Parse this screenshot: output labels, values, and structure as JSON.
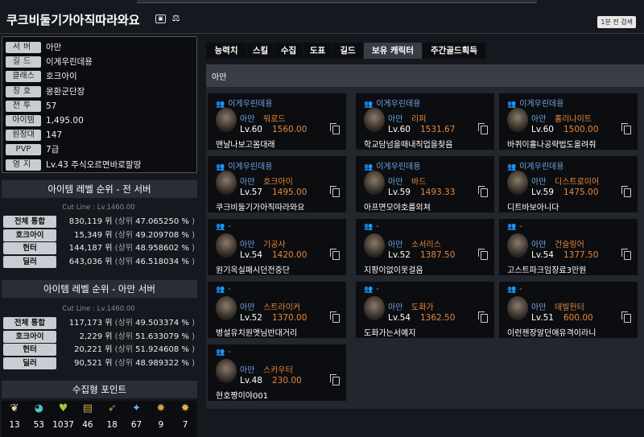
{
  "header": {
    "title": "쿠크비둘기가아직따라와요",
    "badge1": "1분 전 검색"
  },
  "profile": [
    {
      "label": "서버",
      "value": "아만"
    },
    {
      "label": "길드",
      "value": "이게우린데용"
    },
    {
      "label": "클래스",
      "value": "호크아이"
    },
    {
      "label": "칭호",
      "value": "몽환군단장"
    },
    {
      "label": "전투",
      "value": "57"
    },
    {
      "label": "아이템",
      "value": "1,495.00"
    },
    {
      "label": "원정대",
      "value": "147"
    },
    {
      "label": "PVP",
      "value": "7급"
    },
    {
      "label": "영지",
      "value": "Lv.43 주식오르면바로팔땅"
    }
  ],
  "rank_all": {
    "title": "아이템 레벨 순위 - 전 서버",
    "cutline": "Cut Line : Lv.1460.00",
    "rows": [
      {
        "label": "전체 통합",
        "rank": "830,119 위",
        "pct": "47.065250 %"
      },
      {
        "label": "호크아이",
        "rank": "15,349 위",
        "pct": "49.209708 %"
      },
      {
        "label": "헌터",
        "rank": "144,187 위",
        "pct": "48.958602 %"
      },
      {
        "label": "딜러",
        "rank": "643,036 위",
        "pct": "46.518034 %"
      }
    ]
  },
  "rank_server": {
    "title": "아이템 레벨 순위 - 아만 서버",
    "cutline": "Cut Line : Lv.1460.00",
    "rows": [
      {
        "label": "전체 통합",
        "rank": "117,173 위",
        "pct": "49.503374 %"
      },
      {
        "label": "호크아이",
        "rank": "2,229 위",
        "pct": "51.633079 %"
      },
      {
        "label": "헌터",
        "rank": "20,221 위",
        "pct": "51.924608 %"
      },
      {
        "label": "딜러",
        "rank": "90,521 위",
        "pct": "48.989322 %"
      }
    ]
  },
  "rank_common": {
    "open": "(상위",
    "close": ")"
  },
  "collection": {
    "title": "수집형 포인트",
    "items": [
      {
        "icon": "mokoko-icon",
        "glyph": "❦",
        "color": "#e8d8b0",
        "value": "13"
      },
      {
        "icon": "island-icon",
        "glyph": "◕",
        "color": "#4fc3c8",
        "value": "53"
      },
      {
        "icon": "giant-heart-icon",
        "glyph": "♥",
        "color": "#9ac83a",
        "value": "1037"
      },
      {
        "icon": "art-icon",
        "glyph": "▤",
        "color": "#c8a050",
        "value": "46"
      },
      {
        "icon": "voyage-icon",
        "glyph": "➶",
        "color": "#d89a40",
        "value": "18"
      },
      {
        "icon": "ignea-icon",
        "glyph": "✦",
        "color": "#6fb0e8",
        "value": "67"
      },
      {
        "icon": "orpheus-icon",
        "glyph": "✹",
        "color": "#d8a040",
        "value": "9"
      },
      {
        "icon": "world-tree-icon",
        "glyph": "✸",
        "color": "#e8b050",
        "value": "7"
      }
    ]
  },
  "tabs": [
    "능력치",
    "스킬",
    "수집",
    "도표",
    "길드",
    "보유 캐릭터",
    "주간골드획득"
  ],
  "active_tab": "보유 캐릭터",
  "server_label": "아만",
  "characters": [
    {
      "guild": "이게우린데용",
      "server": "아만",
      "cls": "워로드",
      "lv": "Lv.60",
      "ilv": "1560.00",
      "name": "맨날나보고몸대래"
    },
    {
      "guild": "이게우린데용",
      "server": "아만",
      "cls": "리퍼",
      "lv": "Lv.60",
      "ilv": "1531.67",
      "name": "학교담넘을때내직업을찾음"
    },
    {
      "guild": "이게우린데용",
      "server": "아만",
      "cls": "홀리나이트",
      "lv": "Lv.60",
      "ilv": "1500.00",
      "name": "바퀴이홀나공략법도올려줘"
    },
    {
      "guild": "이게우린데용",
      "server": "아만",
      "cls": "호크아이",
      "lv": "Lv.57",
      "ilv": "1495.00",
      "name": "쿠크비둘기가아직따라와요"
    },
    {
      "guild": "이게우린데용",
      "server": "아만",
      "cls": "바드",
      "lv": "Lv.59",
      "ilv": "1493.33",
      "name": "아프면모야호를외쳐"
    },
    {
      "guild": "이게우린데용",
      "server": "아만",
      "cls": "디스트로이어",
      "lv": "Lv.59",
      "ilv": "1475.00",
      "name": "디트바보아니다"
    },
    {
      "guild": "-",
      "server": "아만",
      "cls": "기공사",
      "lv": "Lv.54",
      "ilv": "1420.00",
      "name": "원기옥실패시던전중단"
    },
    {
      "guild": "-",
      "server": "아만",
      "cls": "소서리스",
      "lv": "Lv.52",
      "ilv": "1387.50",
      "name": "지팡이없이못걸음"
    },
    {
      "guild": "-",
      "server": "아만",
      "cls": "건슬링어",
      "lv": "Lv.54",
      "ilv": "1377.50",
      "name": "고스트파크임장료3만원"
    },
    {
      "guild": "-",
      "server": "아만",
      "cls": "스트라이커",
      "lv": "Lv.52",
      "ilv": "1370.00",
      "name": "병설유치원옛님반대거리"
    },
    {
      "guild": "-",
      "server": "아만",
      "cls": "도화가",
      "lv": "Lv.54",
      "ilv": "1362.50",
      "name": "도화가는서예지"
    },
    {
      "guild": "-",
      "server": "아만",
      "cls": "데빌헌터",
      "lv": "Lv.51",
      "ilv": "600.00",
      "name": "이런젠장알던애유격이라니"
    },
    {
      "guild": "-",
      "server": "아만",
      "cls": "스카우터",
      "lv": "Lv.48",
      "ilv": "230.00",
      "name": "현호짱이야001"
    }
  ]
}
